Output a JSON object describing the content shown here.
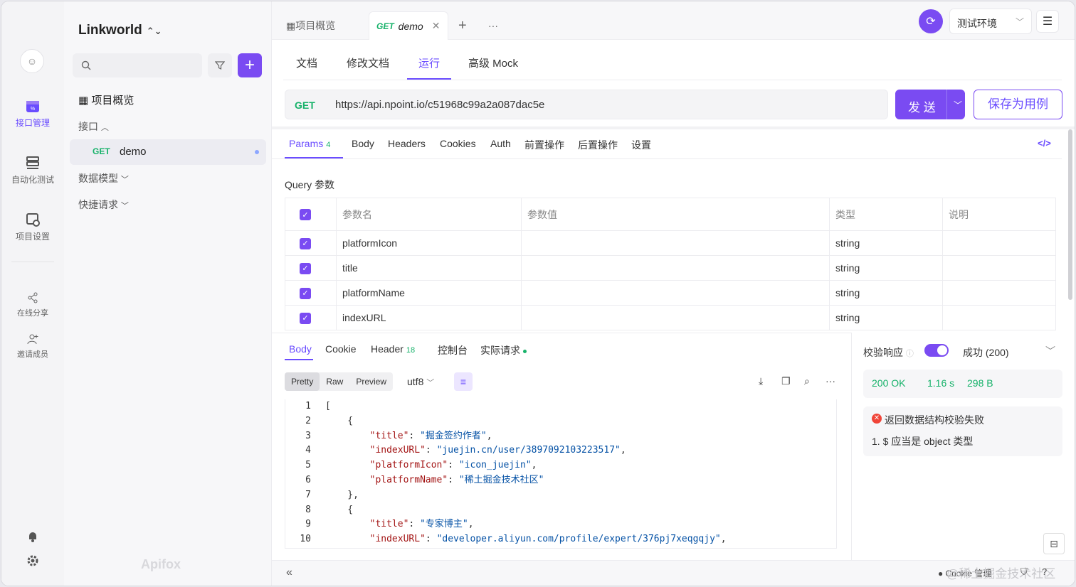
{
  "window": {
    "traffic_lights": [
      "#ff5f57",
      "#febc2e",
      "#28c840"
    ]
  },
  "rail": {
    "items": [
      {
        "label": "接口管理",
        "icon": "api-calendar-icon",
        "active": true
      },
      {
        "label": "自动化测试",
        "icon": "stack-icon",
        "active": false
      },
      {
        "label": "项目设置",
        "icon": "project-settings-icon",
        "active": false
      },
      {
        "label": "在线分享",
        "icon": "share-icon",
        "active": false
      },
      {
        "label": "邀请成员",
        "icon": "invite-user-icon",
        "active": false
      }
    ],
    "bottom_icons": [
      "bell-icon",
      "gear-icon"
    ]
  },
  "sidebar": {
    "project_name": "Linkworld",
    "search_placeholder": "",
    "overview": "项目概览",
    "sections": [
      {
        "label": "接口",
        "expanded": true
      },
      {
        "label": "数据模型",
        "expanded": false
      },
      {
        "label": "快捷请求",
        "expanded": false
      }
    ],
    "selected": {
      "method": "GET",
      "name": "demo"
    },
    "watermark": "Apifox"
  },
  "tabs": {
    "overview": "项目概览",
    "active": {
      "method": "GET",
      "name": "demo"
    }
  },
  "env": {
    "name": "测试环境"
  },
  "doc_tabs": [
    "文档",
    "修改文档",
    "运行",
    "高级 Mock"
  ],
  "doc_tab_active": "运行",
  "request": {
    "method": "GET",
    "url": "https://api.npoint.io/c51968c99a2a087dac5e",
    "send_label": "发 送",
    "save_label": "保存为用例"
  },
  "param_tabs": [
    {
      "label": "Params",
      "count": "4"
    },
    {
      "label": "Body"
    },
    {
      "label": "Headers"
    },
    {
      "label": "Cookies"
    },
    {
      "label": "Auth"
    },
    {
      "label": "前置操作"
    },
    {
      "label": "后置操作"
    },
    {
      "label": "设置"
    }
  ],
  "query": {
    "title": "Query 参数",
    "headers": [
      "参数名",
      "参数值",
      "类型",
      "说明"
    ],
    "rows": [
      {
        "name": "platformIcon",
        "value": "",
        "type": "string",
        "desc": ""
      },
      {
        "name": "title",
        "value": "",
        "type": "string",
        "desc": ""
      },
      {
        "name": "platformName",
        "value": "",
        "type": "string",
        "desc": ""
      },
      {
        "name": "indexURL",
        "value": "",
        "type": "string",
        "desc": ""
      }
    ]
  },
  "response": {
    "tabs": [
      {
        "label": "Body"
      },
      {
        "label": "Cookie"
      },
      {
        "label": "Header",
        "count": "18"
      },
      {
        "label": "控制台"
      },
      {
        "label": "实际请求"
      }
    ],
    "view_modes": [
      "Pretty",
      "Raw",
      "Preview"
    ],
    "encoding": "utf8",
    "code_lines": [
      "[",
      "    {",
      "        \"title\": \"掘金签约作者\",",
      "        \"indexURL\": \"juejin.cn/user/3897092103223517\",",
      "        \"platformIcon\": \"icon_juejin\",",
      "        \"platformName\": \"稀土掘金技术社区\"",
      "    },",
      "    {",
      "        \"title\": \"专家博主\",",
      "        \"indexURL\": \"developer.aliyun.com/profile/expert/376pj7xeqgqjy\","
    ]
  },
  "validation": {
    "label": "校验响应",
    "result": "成功 (200)",
    "status": "200 OK",
    "time": "1.16 s",
    "size": "298 B",
    "error_title": "返回数据结构校验失败",
    "error_detail": "1. $ 应当是 object 类型"
  },
  "footer": {
    "cookie": "Cookie 管理",
    "watermark": "@稀土掘金技术社区"
  },
  "colors": {
    "accent": "#7a4bf2",
    "success": "#17b26a",
    "error": "#f04438"
  }
}
